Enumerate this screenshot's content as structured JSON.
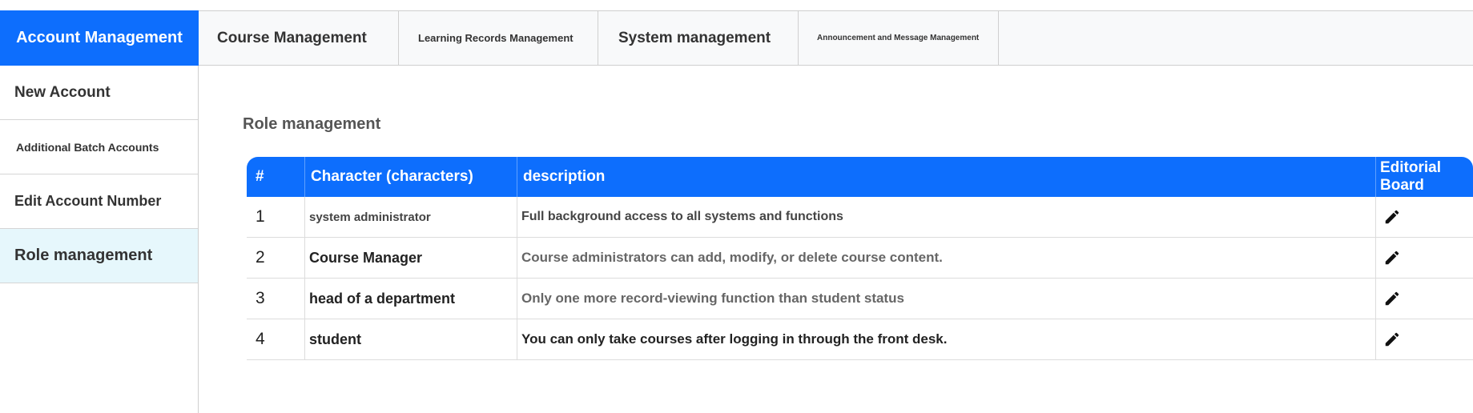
{
  "topnav": {
    "tabs": [
      {
        "label": "Account Management"
      },
      {
        "label": "Course Management"
      },
      {
        "label": "Learning Records Management"
      },
      {
        "label": "System management"
      },
      {
        "label": "Announcement and Message Management"
      }
    ]
  },
  "sidebar": {
    "items": [
      {
        "label": "New Account"
      },
      {
        "label": "Additional Batch Accounts"
      },
      {
        "label": "Edit Account Number"
      },
      {
        "label": "Role management"
      }
    ]
  },
  "main": {
    "section_title": "Role management",
    "table": {
      "headers": [
        "#",
        "Character (characters)",
        "description",
        "Editorial Board"
      ],
      "rows": [
        {
          "num": "1",
          "role": "system administrator",
          "description": "Full background access to all systems and functions"
        },
        {
          "num": "2",
          "role": "Course Manager",
          "description": "Course administrators can add, modify, or delete course content."
        },
        {
          "num": "3",
          "role": "head of a department",
          "description": "Only one more record-viewing function than student status"
        },
        {
          "num": "4",
          "role": "student",
          "description": "You can only take courses after logging in through the front desk."
        }
      ]
    }
  },
  "colors": {
    "accent": "#0d6efd",
    "active_sidebar": "#e6f7fc"
  },
  "icons": {
    "edit": "pencil-icon"
  }
}
